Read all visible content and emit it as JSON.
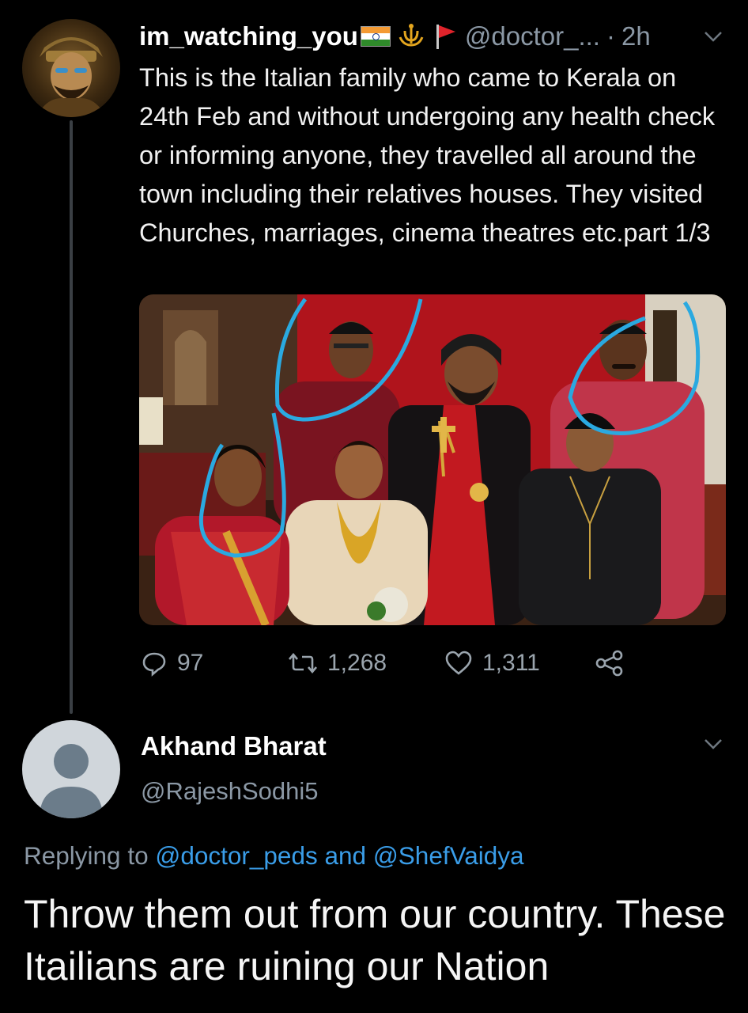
{
  "tweet": {
    "username": "im_watching_you",
    "handle": "@doctor_...",
    "separator": "·",
    "time": "2h",
    "text": "This is the Italian family who came to Kerala on 24th Feb and without undergoing any health check or informing anyone, they travelled all around the town including their relatives houses. They visited Churches, marriages, cinema theatres etc.part 1/3",
    "icons": [
      "india-flag-icon",
      "trident-emblem-icon",
      "red-pennant-icon",
      "chevron-down-icon"
    ],
    "actions": {
      "replies": "97",
      "retweets": "1,268",
      "likes": "1,311"
    }
  },
  "reply": {
    "name": "Akhand Bharat",
    "handle": "@RajeshSodhi5",
    "replying_prefix": "Replying to",
    "mention1": "@doctor_peds",
    "conjunction": "and",
    "mention2": "@ShefVaidya",
    "text": "Throw them out from our country. These Itailians are ruining our Nation"
  },
  "colors": {
    "background": "#000000",
    "secondary_text": "#8b98a5",
    "link": "#3a9de8",
    "highlight_circle": "#2aa9e0"
  }
}
